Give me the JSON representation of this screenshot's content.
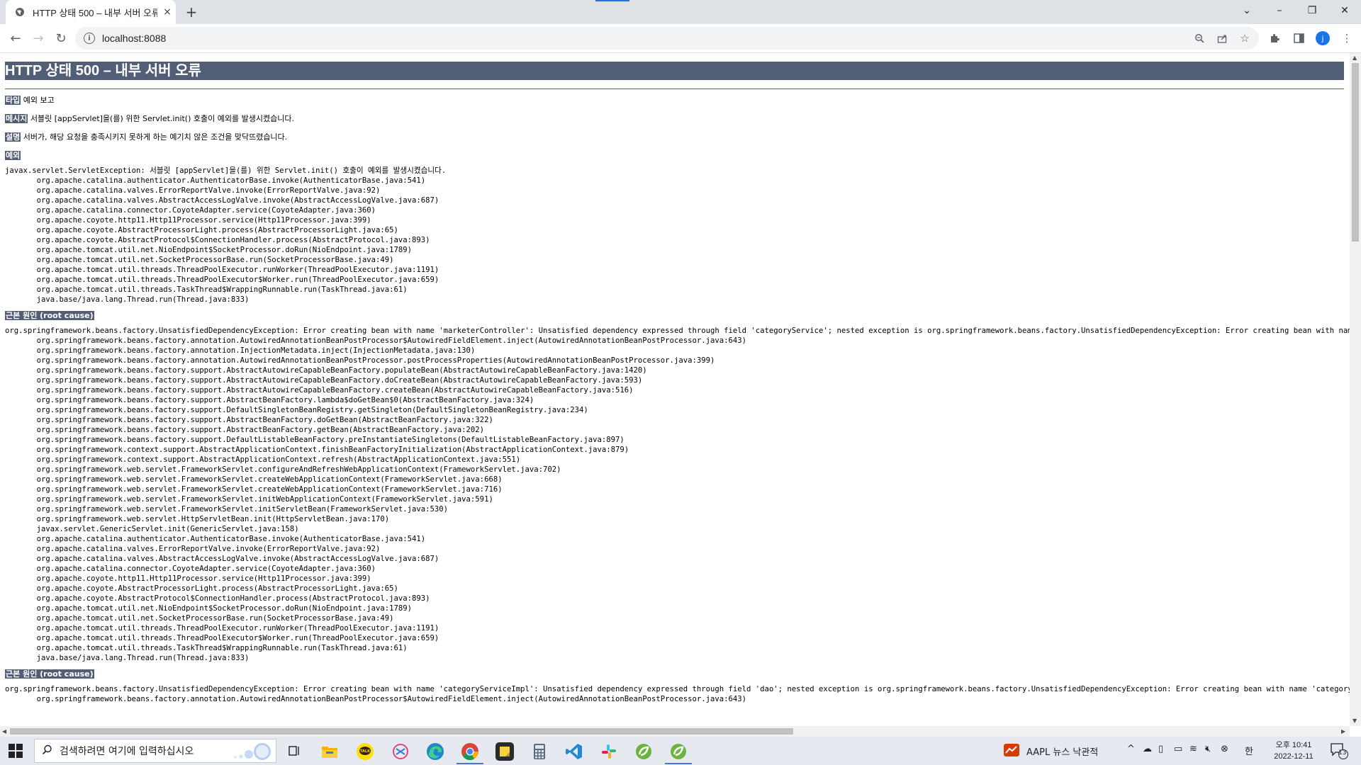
{
  "browser": {
    "tab_title": "HTTP 상태 500 – 내부 서버 오류",
    "tab_close": "×",
    "new_tab": "+",
    "url": "localhost:8088",
    "profile_initial": "j"
  },
  "page": {
    "title": "HTTP 상태 500 – 내부 서버 오류",
    "type_label": "타입",
    "type_value": "예외 보고",
    "message_label": "메시지",
    "message_value": "서블릿 [appServlet]을(를) 위한 Servlet.init() 호출이 예외를 발생시켰습니다.",
    "description_label": "설명",
    "description_value": "서버가, 해당 요청을 충족시키지 못하게 하는 예기치 않은 조건을 맞닥뜨렸습니다.",
    "exception_label": "예외",
    "exception_trace": [
      "javax.servlet.ServletException: 서블릿 [appServlet]을(를) 위한 Servlet.init() 호출이 예외를 발생시켰습니다.",
      "\torg.apache.catalina.authenticator.AuthenticatorBase.invoke(AuthenticatorBase.java:541)",
      "\torg.apache.catalina.valves.ErrorReportValve.invoke(ErrorReportValve.java:92)",
      "\torg.apache.catalina.valves.AbstractAccessLogValve.invoke(AbstractAccessLogValve.java:687)",
      "\torg.apache.catalina.connector.CoyoteAdapter.service(CoyoteAdapter.java:360)",
      "\torg.apache.coyote.http11.Http11Processor.service(Http11Processor.java:399)",
      "\torg.apache.coyote.AbstractProcessorLight.process(AbstractProcessorLight.java:65)",
      "\torg.apache.coyote.AbstractProtocol$ConnectionHandler.process(AbstractProtocol.java:893)",
      "\torg.apache.tomcat.util.net.NioEndpoint$SocketProcessor.doRun(NioEndpoint.java:1789)",
      "\torg.apache.tomcat.util.net.SocketProcessorBase.run(SocketProcessorBase.java:49)",
      "\torg.apache.tomcat.util.threads.ThreadPoolExecutor.runWorker(ThreadPoolExecutor.java:1191)",
      "\torg.apache.tomcat.util.threads.ThreadPoolExecutor$Worker.run(ThreadPoolExecutor.java:659)",
      "\torg.apache.tomcat.util.threads.TaskThread$WrappingRunnable.run(TaskThread.java:61)",
      "\tjava.base/java.lang.Thread.run(Thread.java:833)"
    ],
    "root_cause_label": "근본 원인 (root cause)",
    "root_cause_trace_1": [
      "org.springframework.beans.factory.UnsatisfiedDependencyException: Error creating bean with name 'marketerController': Unsatisfied dependency expressed through field 'categoryService'; nested exception is org.springframework.beans.factory.UnsatisfiedDependencyException: Error creating bean with name 'categoryService",
      "\torg.springframework.beans.factory.annotation.AutowiredAnnotationBeanPostProcessor$AutowiredFieldElement.inject(AutowiredAnnotationBeanPostProcessor.java:643)",
      "\torg.springframework.beans.factory.annotation.InjectionMetadata.inject(InjectionMetadata.java:130)",
      "\torg.springframework.beans.factory.annotation.AutowiredAnnotationBeanPostProcessor.postProcessProperties(AutowiredAnnotationBeanPostProcessor.java:399)",
      "\torg.springframework.beans.factory.support.AbstractAutowireCapableBeanFactory.populateBean(AbstractAutowireCapableBeanFactory.java:1420)",
      "\torg.springframework.beans.factory.support.AbstractAutowireCapableBeanFactory.doCreateBean(AbstractAutowireCapableBeanFactory.java:593)",
      "\torg.springframework.beans.factory.support.AbstractAutowireCapableBeanFactory.createBean(AbstractAutowireCapableBeanFactory.java:516)",
      "\torg.springframework.beans.factory.support.AbstractBeanFactory.lambda$doGetBean$0(AbstractBeanFactory.java:324)",
      "\torg.springframework.beans.factory.support.DefaultSingletonBeanRegistry.getSingleton(DefaultSingletonBeanRegistry.java:234)",
      "\torg.springframework.beans.factory.support.AbstractBeanFactory.doGetBean(AbstractBeanFactory.java:322)",
      "\torg.springframework.beans.factory.support.AbstractBeanFactory.getBean(AbstractBeanFactory.java:202)",
      "\torg.springframework.beans.factory.support.DefaultListableBeanFactory.preInstantiateSingletons(DefaultListableBeanFactory.java:897)",
      "\torg.springframework.context.support.AbstractApplicationContext.finishBeanFactoryInitialization(AbstractApplicationContext.java:879)",
      "\torg.springframework.context.support.AbstractApplicationContext.refresh(AbstractApplicationContext.java:551)",
      "\torg.springframework.web.servlet.FrameworkServlet.configureAndRefreshWebApplicationContext(FrameworkServlet.java:702)",
      "\torg.springframework.web.servlet.FrameworkServlet.createWebApplicationContext(FrameworkServlet.java:668)",
      "\torg.springframework.web.servlet.FrameworkServlet.createWebApplicationContext(FrameworkServlet.java:716)",
      "\torg.springframework.web.servlet.FrameworkServlet.initWebApplicationContext(FrameworkServlet.java:591)",
      "\torg.springframework.web.servlet.FrameworkServlet.initServletBean(FrameworkServlet.java:530)",
      "\torg.springframework.web.servlet.HttpServletBean.init(HttpServletBean.java:170)",
      "\tjavax.servlet.GenericServlet.init(GenericServlet.java:158)",
      "\torg.apache.catalina.authenticator.AuthenticatorBase.invoke(AuthenticatorBase.java:541)",
      "\torg.apache.catalina.valves.ErrorReportValve.invoke(ErrorReportValve.java:92)",
      "\torg.apache.catalina.valves.AbstractAccessLogValve.invoke(AbstractAccessLogValve.java:687)",
      "\torg.apache.catalina.connector.CoyoteAdapter.service(CoyoteAdapter.java:360)",
      "\torg.apache.coyote.http11.Http11Processor.service(Http11Processor.java:399)",
      "\torg.apache.coyote.AbstractProcessorLight.process(AbstractProcessorLight.java:65)",
      "\torg.apache.coyote.AbstractProtocol$ConnectionHandler.process(AbstractProtocol.java:893)",
      "\torg.apache.tomcat.util.net.NioEndpoint$SocketProcessor.doRun(NioEndpoint.java:1789)",
      "\torg.apache.tomcat.util.net.SocketProcessorBase.run(SocketProcessorBase.java:49)",
      "\torg.apache.tomcat.util.threads.ThreadPoolExecutor.runWorker(ThreadPoolExecutor.java:1191)",
      "\torg.apache.tomcat.util.threads.ThreadPoolExecutor$Worker.run(ThreadPoolExecutor.java:659)",
      "\torg.apache.tomcat.util.threads.TaskThread$WrappingRunnable.run(TaskThread.java:61)",
      "\tjava.base/java.lang.Thread.run(Thread.java:833)"
    ],
    "root_cause_trace_2": [
      "org.springframework.beans.factory.UnsatisfiedDependencyException: Error creating bean with name 'categoryServiceImpl': Unsatisfied dependency expressed through field 'dao'; nested exception is org.springframework.beans.factory.UnsatisfiedDependencyException: Error creating bean with name 'categoryDAOImpl': Unsatisf",
      "\torg.springframework.beans.factory.annotation.AutowiredAnnotationBeanPostProcessor$AutowiredFieldElement.inject(AutowiredAnnotationBeanPostProcessor.java:643)"
    ]
  },
  "taskbar": {
    "search_placeholder": "검색하려면 여기에 입력하십시오",
    "ticker": "AAPL  뉴스 낙관적",
    "ime": "한",
    "time": "오후 10:41",
    "date": "2022-12-11",
    "notification_count": "13"
  },
  "colors": {
    "header_bg": "#525d76",
    "accent": "#1a73e8"
  }
}
